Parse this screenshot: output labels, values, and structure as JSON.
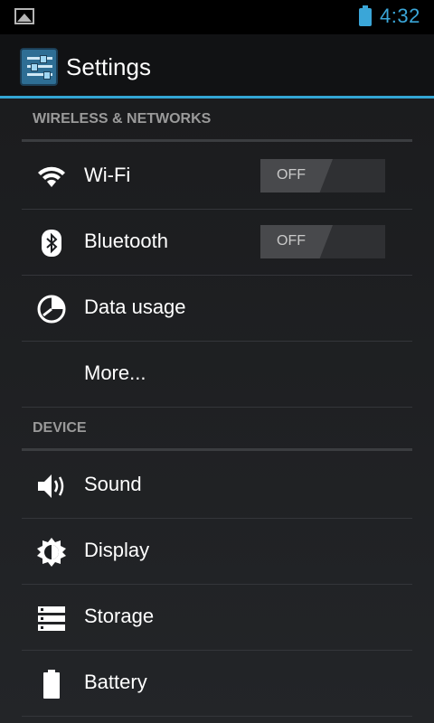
{
  "status_bar": {
    "time": "4:32"
  },
  "app_bar": {
    "title": "Settings"
  },
  "sections": {
    "wireless": {
      "header": "WIRELESS & NETWORKS",
      "wifi": {
        "label": "Wi-Fi",
        "toggle": "OFF",
        "icon": "wifi-icon"
      },
      "bluetooth": {
        "label": "Bluetooth",
        "toggle": "OFF",
        "icon": "bluetooth-icon"
      },
      "data_usage": {
        "label": "Data usage",
        "icon": "data-usage-icon"
      },
      "more": {
        "label": "More..."
      }
    },
    "device": {
      "header": "DEVICE",
      "sound": {
        "label": "Sound",
        "icon": "sound-icon"
      },
      "display": {
        "label": "Display",
        "icon": "display-icon"
      },
      "storage": {
        "label": "Storage",
        "icon": "storage-icon"
      },
      "battery": {
        "label": "Battery",
        "icon": "battery-icon"
      }
    }
  },
  "colors": {
    "accent": "#33a6d4",
    "background": "#1c1e21"
  }
}
